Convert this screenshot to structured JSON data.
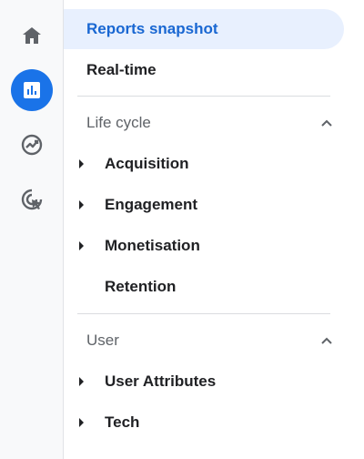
{
  "rail": {
    "items": [
      {
        "icon": "home-icon"
      },
      {
        "icon": "reports-icon",
        "active": true
      },
      {
        "icon": "explore-icon"
      },
      {
        "icon": "advertising-icon"
      }
    ]
  },
  "nav": {
    "reports_snapshot": "Reports snapshot",
    "realtime": "Real-time",
    "lifecycle": {
      "title": "Life cycle",
      "items": [
        "Acquisition",
        "Engagement",
        "Monetisation",
        "Retention"
      ]
    },
    "user": {
      "title": "User",
      "items": [
        "User Attributes",
        "Tech"
      ]
    }
  },
  "colors": {
    "accent": "#1a73e8",
    "selected_bg": "#e8f0fe",
    "selected_text": "#1967d2"
  }
}
